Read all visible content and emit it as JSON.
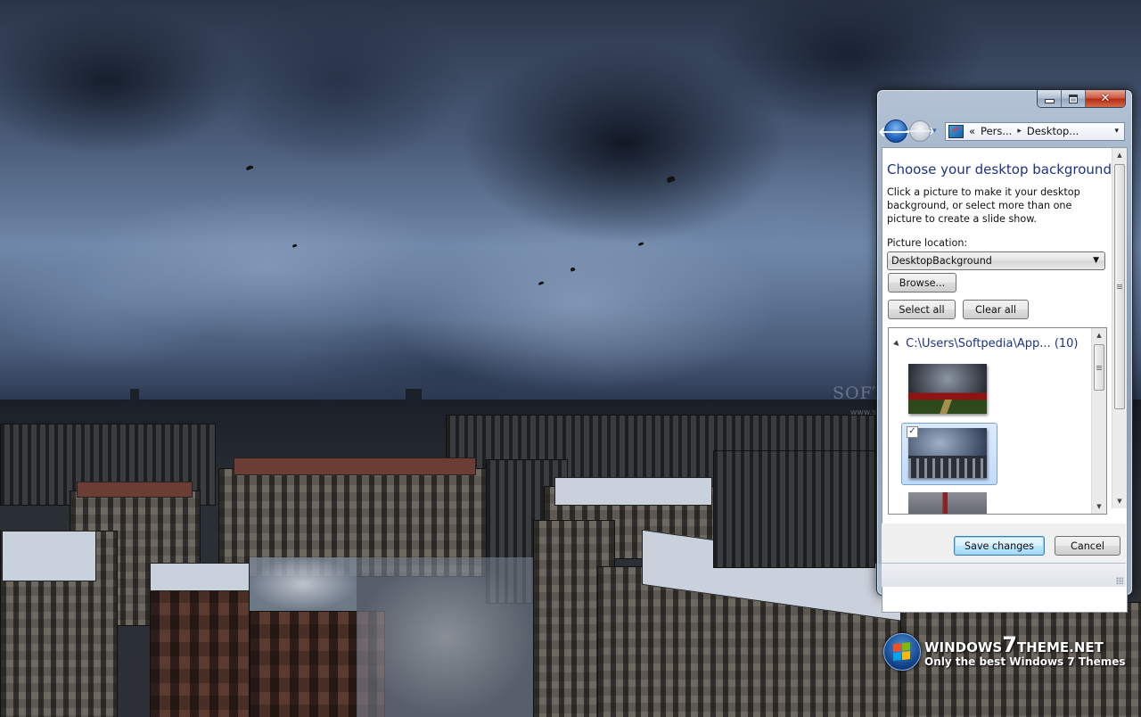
{
  "desktop": {
    "wallpaper": "Stormy clouds over snowy city rooftops (HDR)",
    "watermark": {
      "text": "SOFTPEDIA",
      "url": "www.softpedia.com"
    },
    "branding": {
      "title_prefix": "WINDOWS",
      "title_seven": "7",
      "title_suffix": "THEME.NET",
      "subtitle": "Only the best Windows 7 Themes",
      "icon": "windows-orb-icon"
    }
  },
  "window": {
    "caption_buttons": {
      "minimize": {
        "icon": "minimize-icon",
        "glyph": ""
      },
      "maximize": {
        "icon": "maximize-icon",
        "glyph": ""
      },
      "close": {
        "icon": "close-icon",
        "glyph": "✕"
      }
    },
    "nav": {
      "back_glyph": "🡐",
      "forward_glyph": "🡒",
      "recent_glyph": "▾",
      "address": {
        "icon": "control-panel-icon",
        "overflow": "«",
        "crumbs": [
          "Pers...",
          "Desktop..."
        ],
        "separator": "▸",
        "dropdown_glyph": "▾"
      }
    },
    "content": {
      "heading": "Choose your desktop background",
      "description": "Click a picture to make it your desktop background, or select more than one picture to create a slide show.",
      "picture_location_label": "Picture location:",
      "picture_location_value": "DesktopBackground",
      "browse_label": "Browse...",
      "select_all_label": "Select all",
      "clear_all_label": "Clear all",
      "picker": {
        "group_label": "C:\\Users\\Softpedia\\App... (10)",
        "group_toggle_glyph": "◢",
        "thumbnails": [
          {
            "name": "Tulip field under storm clouds",
            "selected": false
          },
          {
            "name": "Stormy city rooftops",
            "selected": true,
            "checkbox_glyph": "✓"
          },
          {
            "name": "Golden Gate bridge in clouds",
            "selected": false
          }
        ]
      }
    },
    "footer": {
      "save_label": "Save changes",
      "cancel_label": "Cancel"
    }
  }
}
